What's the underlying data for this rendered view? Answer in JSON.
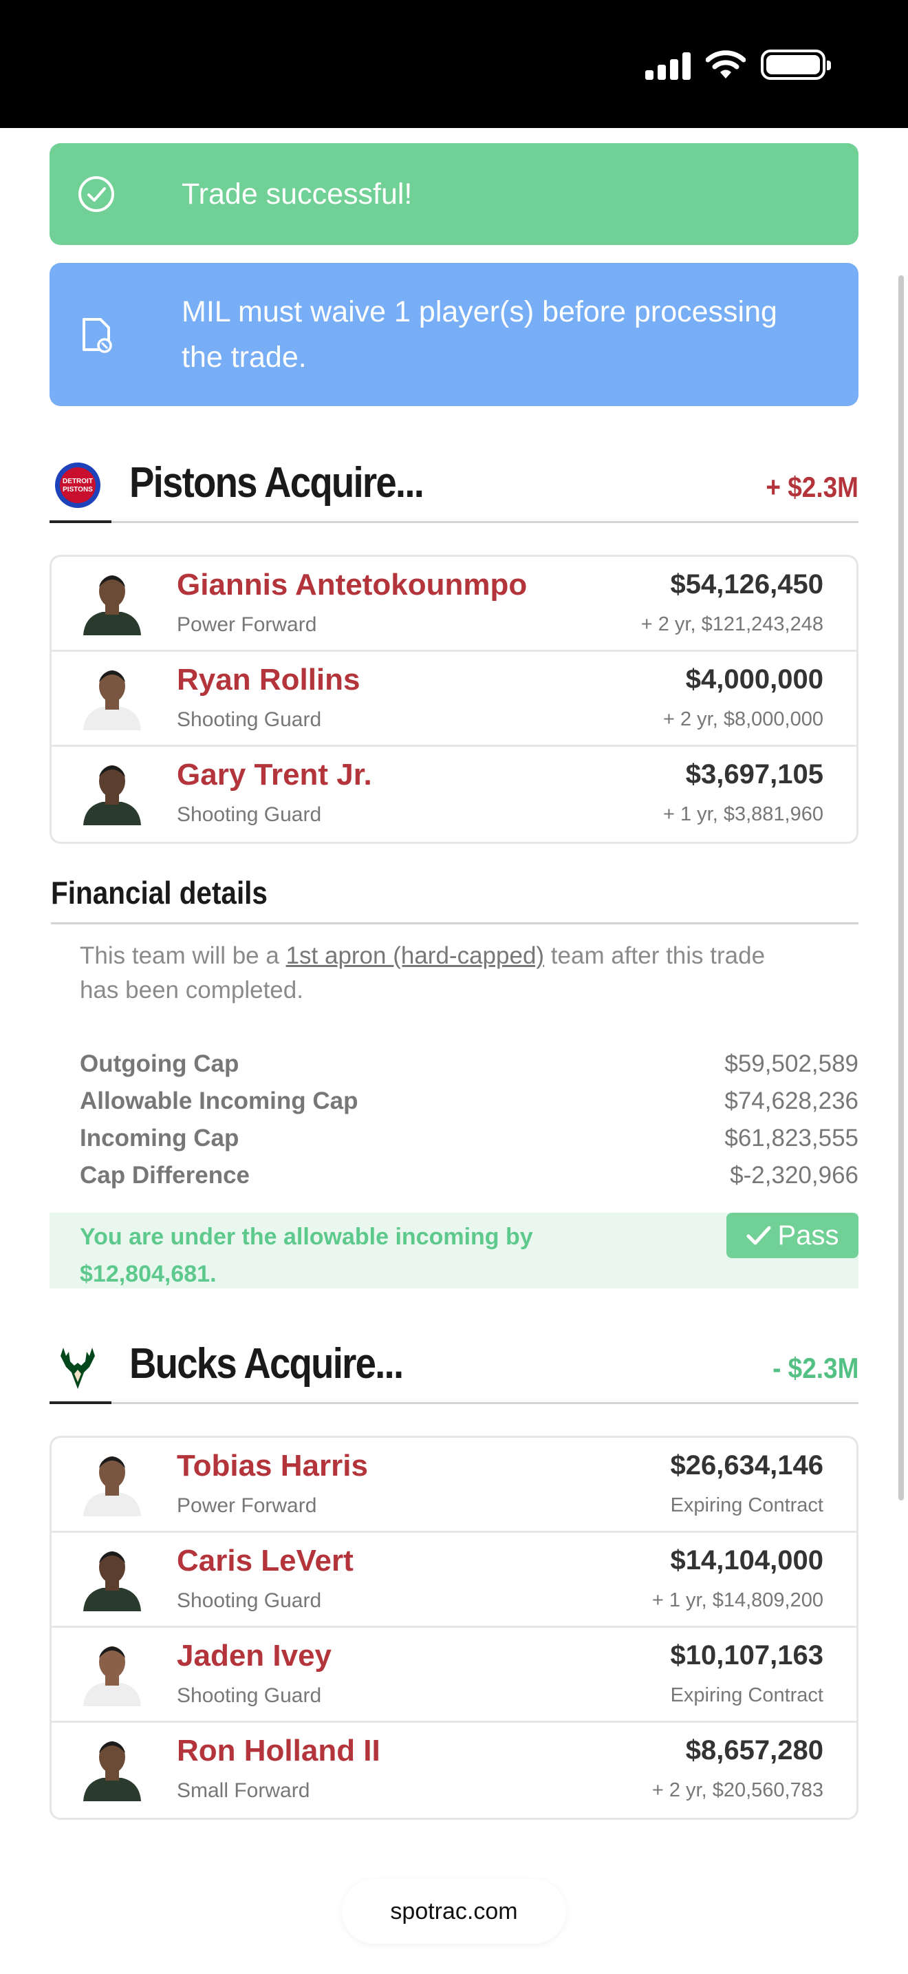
{
  "alerts": {
    "success": "Trade successful!",
    "info": "MIL must waive 1 player(s) before processing the trade."
  },
  "pistons": {
    "title": "Pistons Acquire...",
    "delta": "+ $2.3M",
    "players": [
      {
        "name": "Giannis Antetokounmpo",
        "position": "Power Forward",
        "salary": "$54,126,450",
        "contract": "+ 2 yr, $121,243,248"
      },
      {
        "name": "Ryan Rollins",
        "position": "Shooting Guard",
        "salary": "$4,000,000",
        "contract": "+ 2 yr, $8,000,000"
      },
      {
        "name": "Gary Trent Jr.",
        "position": "Shooting Guard",
        "salary": "$3,697,105",
        "contract": "+ 1 yr, $3,881,960"
      }
    ]
  },
  "financial": {
    "title": "Financial details",
    "note_before": "This team will be a ",
    "note_link": "1st apron (hard-capped)",
    "note_after": " team after this trade has been completed.",
    "rows": [
      {
        "label": "Outgoing Cap",
        "value": "$59,502,589"
      },
      {
        "label": "Allowable Incoming Cap",
        "value": "$74,628,236"
      },
      {
        "label": "Incoming Cap",
        "value": "$61,823,555"
      },
      {
        "label": "Cap Difference",
        "value": "$-2,320,966"
      }
    ],
    "pass_message": "You are under the allowable incoming by $12,804,681.",
    "pass_label": "Pass"
  },
  "bucks": {
    "title": "Bucks Acquire...",
    "delta": "- $2.3M",
    "players": [
      {
        "name": "Tobias Harris",
        "position": "Power Forward",
        "salary": "$26,634,146",
        "contract": "Expiring Contract"
      },
      {
        "name": "Caris LeVert",
        "position": "Shooting Guard",
        "salary": "$14,104,000",
        "contract": "+ 1 yr, $14,809,200"
      },
      {
        "name": "Jaden Ivey",
        "position": "Shooting Guard",
        "salary": "$10,107,163",
        "contract": "Expiring Contract"
      },
      {
        "name": "Ron Holland II",
        "position": "Small Forward",
        "salary": "$8,657,280",
        "contract": "+ 2 yr, $20,560,783"
      }
    ]
  },
  "browser": {
    "domain": "spotrac.com"
  },
  "logos": {
    "pistons_text_1": "DETROIT",
    "pistons_text_2": "PISTONS"
  },
  "colors": {
    "success": "#71d096",
    "info": "#78aef5",
    "player_name": "#b3343a",
    "positive_delta": "#b3343a",
    "negative_delta": "#54c084"
  },
  "icons": {
    "success": "check-circle-icon",
    "info": "document-warning-icon",
    "pass": "checkmark-icon"
  }
}
